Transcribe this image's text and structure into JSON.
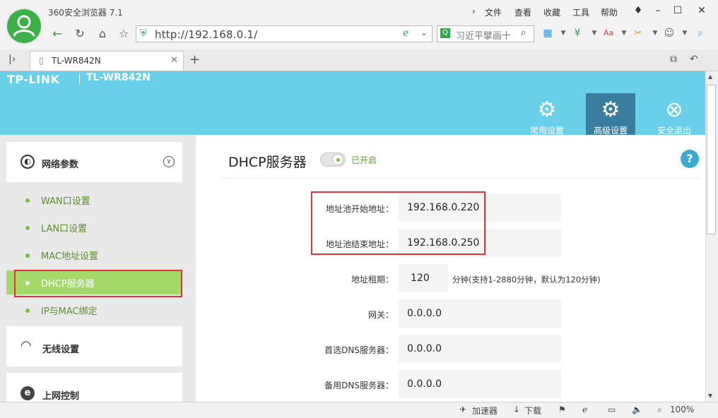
{
  "browser": {
    "app_title": "360安全浏览器 7.1",
    "menus": [
      "文件",
      "查看",
      "收藏",
      "工具",
      "帮助"
    ],
    "address": "http://192.168.0.1/",
    "search_text": "习近平擘画十",
    "tab_title": "TL-WR842N",
    "new_tab": "+"
  },
  "header": {
    "brand": "TP-LINK",
    "model": "TL-WR842N",
    "buttons": [
      {
        "label": "常用设置",
        "icon": "gear-icon"
      },
      {
        "label": "高级设置",
        "icon": "gears-icon"
      },
      {
        "label": "安全退出",
        "icon": "close-circle-icon"
      }
    ]
  },
  "sidebar": {
    "network_title": "网络参数",
    "items": [
      "WAN口设置",
      "LAN口设置",
      "MAC地址设置",
      "DHCP服务器",
      "IP与MAC绑定"
    ],
    "wireless_title": "无线设置",
    "access_title": "上网控制"
  },
  "main": {
    "title": "DHCP服务器",
    "toggle_status": "已开启",
    "help": "?",
    "fields": [
      {
        "label": "地址池开始地址：",
        "value": "192.168.0.220"
      },
      {
        "label": "地址池结束地址：",
        "value": "192.168.0.250"
      },
      {
        "label": "地址租期：",
        "value": "120"
      },
      {
        "label": "网关：",
        "value": "0.0.0.0"
      },
      {
        "label": "首选DNS服务器：",
        "value": "0.0.0.0"
      },
      {
        "label": "备用DNS服务器：",
        "value": "0.0.0.0"
      }
    ],
    "lease_hint": "分钟(支持1-2880分钟，默认为120分钟)"
  },
  "statusbar": {
    "accelerator": "加速器",
    "download": "下载",
    "zoom": "100%"
  }
}
